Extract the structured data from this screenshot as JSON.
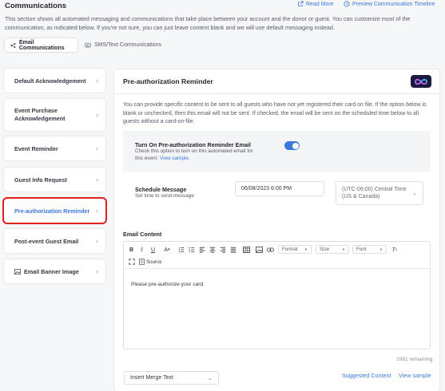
{
  "header": {
    "title": "Communications",
    "read_more": "Read More",
    "preview_timeline": "Preview Communication Timeline",
    "description": "This section shows all automated messaging and communications that take place between your account and the donor or guest. You can customize most of the communication, as indicated below. If you're not sure, you can just leave content blank and we will use default messaging instead."
  },
  "tabs": [
    {
      "label": "Email Communications",
      "icon": "share-icon",
      "active": true
    },
    {
      "label": "SMS/Text Communications",
      "icon": "message-icon",
      "active": false
    }
  ],
  "sidebar": {
    "items": [
      {
        "label": "Default Acknowledgement"
      },
      {
        "label": "Event Purchase Acknowledgement"
      },
      {
        "label": "Event Reminder"
      },
      {
        "label": "Guest Info Request"
      },
      {
        "label": "Pre-authorization Reminder",
        "selected": true
      },
      {
        "label": "Post-event Guest Email"
      },
      {
        "label": "Email Banner Image",
        "icon": "image-icon"
      }
    ]
  },
  "panel": {
    "title": "Pre-authorization Reminder",
    "description": "You can provide specific content to be sent to all guests who have not yet registered their card on file. If the option below is blank or unchecked, then this email will not be sent. If checked, the email will be sent on the scheduled time below to all guests without a card-on-file.",
    "toggle": {
      "title": "Turn On Pre-authorization Reminder Email",
      "hint": "Check this option to turn on this automated email for this event.",
      "view_sample": "View sample.",
      "on": true
    },
    "schedule": {
      "title": "Schedule Message",
      "hint": "Set time to send message",
      "datetime": "06/08/2023 6:00 PM",
      "timezone_line1": "(UTC-06:00) Central Time",
      "timezone_line2": "(US & Canada)"
    },
    "email_content": {
      "label": "Email Content",
      "toolbar": {
        "format": "Format",
        "size": "Size",
        "font": "Font",
        "source": "Source"
      },
      "body": "Please pre-authorize your card.",
      "remaining": "1961 remaining"
    },
    "merge_text": "Insert Merge Text",
    "suggested_content": "Suggested Content",
    "view_sample": "View sample"
  },
  "colors": {
    "accent": "#3b78d8",
    "selected_outline": "#e02020",
    "background": "#f6f7f9"
  }
}
